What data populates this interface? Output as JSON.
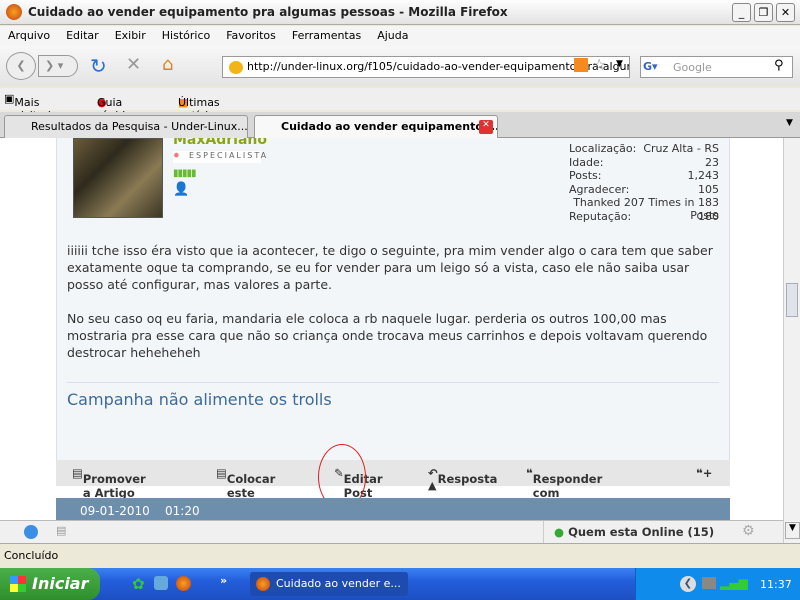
{
  "window": {
    "title": "Cuidado ao vender equipamento pra algumas pessoas - Mozilla Firefox"
  },
  "menu": [
    "Arquivo",
    "Editar",
    "Exibir",
    "Histórico",
    "Favoritos",
    "Ferramentas",
    "Ajuda"
  ],
  "nav": {
    "url": "http://under-linux.org/f105/cuidado-ao-vender-equipamento-pra-algur",
    "search_placeholder": "Google"
  },
  "bookmarks": [
    "Mais visitados",
    "Guia rápido",
    "Últimas notícias"
  ],
  "tabs": [
    {
      "label": "Resultados da Pesquisa - Under-Linux....",
      "active": false
    },
    {
      "label": "Cuidado ao vender equipamento ...",
      "active": true
    }
  ],
  "post": {
    "username": "MaxAdriano",
    "rank": "ESPECIALISTA",
    "stats": [
      [
        "Localização:",
        "Cruz Alta - RS"
      ],
      [
        "Idade:",
        "23"
      ],
      [
        "Posts:",
        "1,243"
      ],
      [
        "Agradecer:",
        "105"
      ]
    ],
    "thanked": "Thanked 207 Times in 183 Posts",
    "reputation": [
      "Reputação:",
      "180"
    ],
    "paragraphs": [
      "iiiiii tche isso éra visto que ia acontecer, te digo o seguinte, pra mim vender algo o cara tem que saber exatamente oque ta comprando, se eu for vender para um leigo só a vista, caso ele não saiba usar posso até configurar, mas valores a parte.",
      "No seu caso oq eu faria, mandaria ele coloca a rb naquele lugar. perderia os outros 100,00 mas mostraria pra esse cara que não so criança onde trocava meus carrinhos e depois voltavam querendo destrocar heheheheh"
    ],
    "signature": "Campanha não alimente os trolls",
    "actions": [
      "Promover a Artigo",
      "Colocar este post no Blog",
      "Editar Post",
      "Resposta",
      "Responder com Citação"
    ]
  },
  "next_post": {
    "date": "09-01-2010",
    "time": "01:20"
  },
  "addon_bar": {
    "online": "Quem esta Online (15)"
  },
  "status": "Concluído",
  "taskbar": {
    "start": "Iniciar",
    "task": "Cuidado ao vender e...",
    "lang": "PT",
    "clock": "11:37"
  },
  "colors": {
    "accent": "#3d6a98",
    "post_header": "#6d8fad",
    "username": "#8aa31a"
  }
}
